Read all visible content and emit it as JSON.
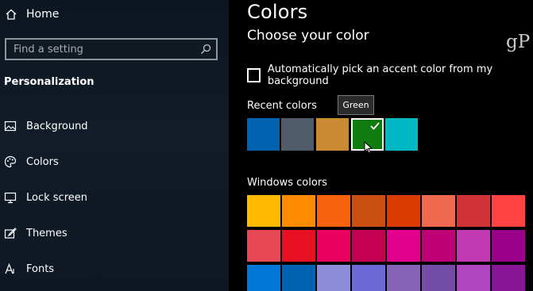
{
  "sidebar": {
    "home_label": "Home",
    "search_placeholder": "Find a setting",
    "section_title": "Personalization",
    "items": [
      {
        "label": "Background",
        "icon": "image-icon"
      },
      {
        "label": "Colors",
        "icon": "palette-icon"
      },
      {
        "label": "Lock screen",
        "icon": "monitor-icon"
      },
      {
        "label": "Themes",
        "icon": "brush-icon"
      },
      {
        "label": "Fonts",
        "icon": "font-icon"
      }
    ]
  },
  "main": {
    "title": "Colors",
    "subtitle": "Choose your color",
    "watermark": "gP",
    "auto_accent_label": "Automatically pick an accent color from my background",
    "auto_accent_checked": false,
    "recent_colors_label": "Recent colors",
    "recent_colors": [
      "#0063b1",
      "#515c6b",
      "#ca8b32",
      "#107c10",
      "#00b7c3"
    ],
    "selected_recent_color": "Green",
    "tooltip": "Green",
    "windows_colors_label": "Windows colors",
    "windows_colors": [
      [
        "#ffb900",
        "#ff8c00",
        "#f7630c",
        "#ca5010",
        "#da3b01",
        "#ef6950",
        "#d13438",
        "#ff4343"
      ],
      [
        "#e74856",
        "#e81123",
        "#ea005e",
        "#c30052",
        "#e3008c",
        "#bf0077",
        "#c239b3",
        "#9a0089"
      ],
      [
        "#0078d7",
        "#0063b1",
        "#8e8cd8",
        "#6b69d6",
        "#8764b8",
        "#744da9",
        "#b146c2",
        "#881798"
      ]
    ]
  }
}
